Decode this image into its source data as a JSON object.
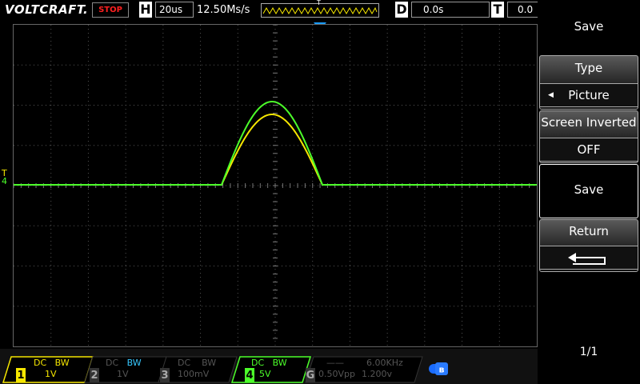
{
  "header": {
    "brand": "VOLTCRAFT.",
    "run_state": "STOP",
    "horizontal_label": "H",
    "timebase": "20us",
    "sample_rate": "12.50Ms/s",
    "trigger_marker": "T",
    "delay_label": "D",
    "delay_value": "0.0s",
    "trigger_label": "T",
    "trigger_value": "0.0"
  },
  "menu": {
    "title": "Save",
    "type_label": "Type",
    "type_value": "Picture",
    "screen_inverted_label": "Screen Inverted",
    "screen_inverted_value": "OFF",
    "save_button": "Save",
    "return_label": "Return",
    "page": "1/1"
  },
  "channels": [
    {
      "num": "1",
      "coupling": "DC",
      "bw": "BW",
      "scale": "1V",
      "active": true,
      "color": "#f5e600"
    },
    {
      "num": "2",
      "coupling": "DC",
      "bw": "BW",
      "scale": "1V",
      "active": false,
      "color": "#37c8ff"
    },
    {
      "num": "3",
      "coupling": "DC",
      "bw": "BW",
      "scale": "100mV",
      "active": false,
      "color": "#888888"
    },
    {
      "num": "4",
      "coupling": "DC",
      "bw": "BW",
      "scale": "5V",
      "active": true,
      "color": "#4cff2a"
    }
  ],
  "generator": {
    "label": "G",
    "frequency": "6.00KHz",
    "amplitude": "0.50Vpp",
    "offset": "1.200v"
  },
  "markers": {
    "trigger_level": "T",
    "channel_ref": "4"
  },
  "colors": {
    "ch1": "#f5e600",
    "ch4": "#4cff2a",
    "trigger": "#1a9cff",
    "grid": "#555555"
  }
}
